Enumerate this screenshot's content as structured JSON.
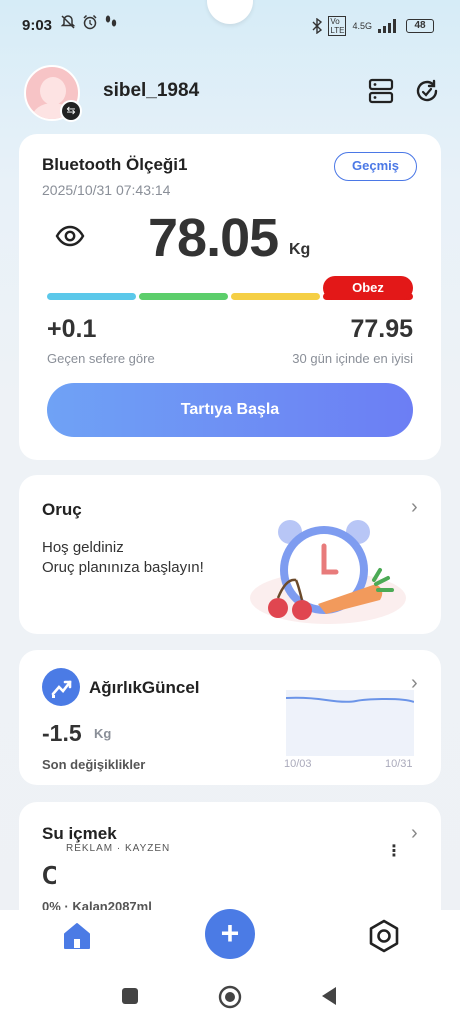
{
  "status_bar": {
    "time": "9:03",
    "network": "4.5G",
    "battery": "48"
  },
  "header": {
    "username": "sibel_1984"
  },
  "scale_card": {
    "device_name": "Bluetooth Ölçeği1",
    "datetime": "2025/10/31 07:43:14",
    "history_label": "Geçmiş",
    "weight": "78.05",
    "unit": "Kg",
    "category": "Obez",
    "change_value": "+0.1",
    "change_label": "Geçen sefere göre",
    "best_value": "77.95",
    "best_label": "30 gün içinde en iyisi",
    "start_button": "Tartıya Başla",
    "bar_colors": [
      "#5bc8ea",
      "#5cce6b",
      "#f5cf45",
      "#e31818"
    ]
  },
  "fasting_card": {
    "title": "Oruç",
    "line1": "Hoş geldiniz",
    "line2": "Oruç planınıza başlayın!"
  },
  "trend_card": {
    "title": "AğırlıkGüncel",
    "value": "-1.5",
    "unit": "Kg",
    "label": "Son değişiklikler",
    "x_start": "10/03",
    "x_end": "10/31"
  },
  "water_card": {
    "title": "Su içmek",
    "ad_label": "REKLAM · KAYZEN",
    "digit": "C",
    "sub": "0% · Kalan2087ml"
  },
  "colors": {
    "accent": "#4b7be5",
    "danger": "#e31818"
  }
}
